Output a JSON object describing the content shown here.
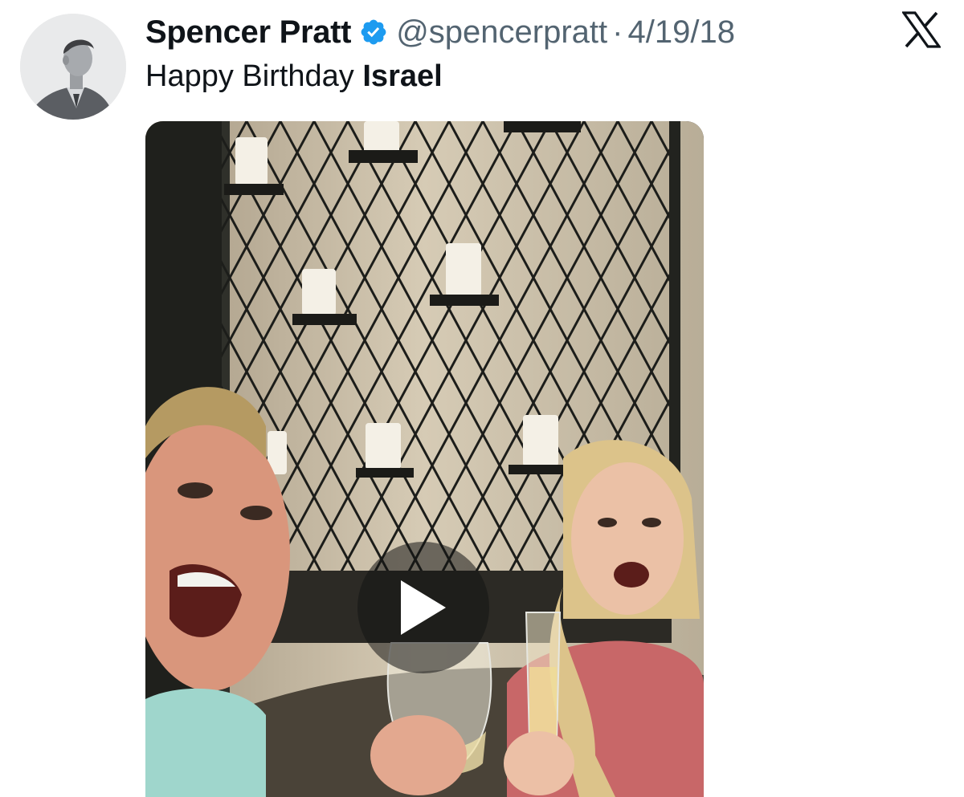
{
  "tweet": {
    "author": {
      "display_name": "Spencer Pratt",
      "handle": "@spencerpratt",
      "verified": true,
      "avatar_icon": "profile-photo"
    },
    "separator": "·",
    "date": "4/19/18",
    "text_plain": "Happy Birthday ",
    "text_bold": "Israel",
    "media": {
      "type": "video",
      "thumbnail": "two people toasting with wine glasses in front of a lattice wall with candles",
      "play_icon": "play-icon"
    }
  },
  "brand": {
    "logo_icon": "x-logo-icon"
  },
  "colors": {
    "text_primary": "#0f1419",
    "text_secondary": "#536471",
    "verified_blue": "#1d9bf0",
    "play_overlay": "#141414"
  }
}
